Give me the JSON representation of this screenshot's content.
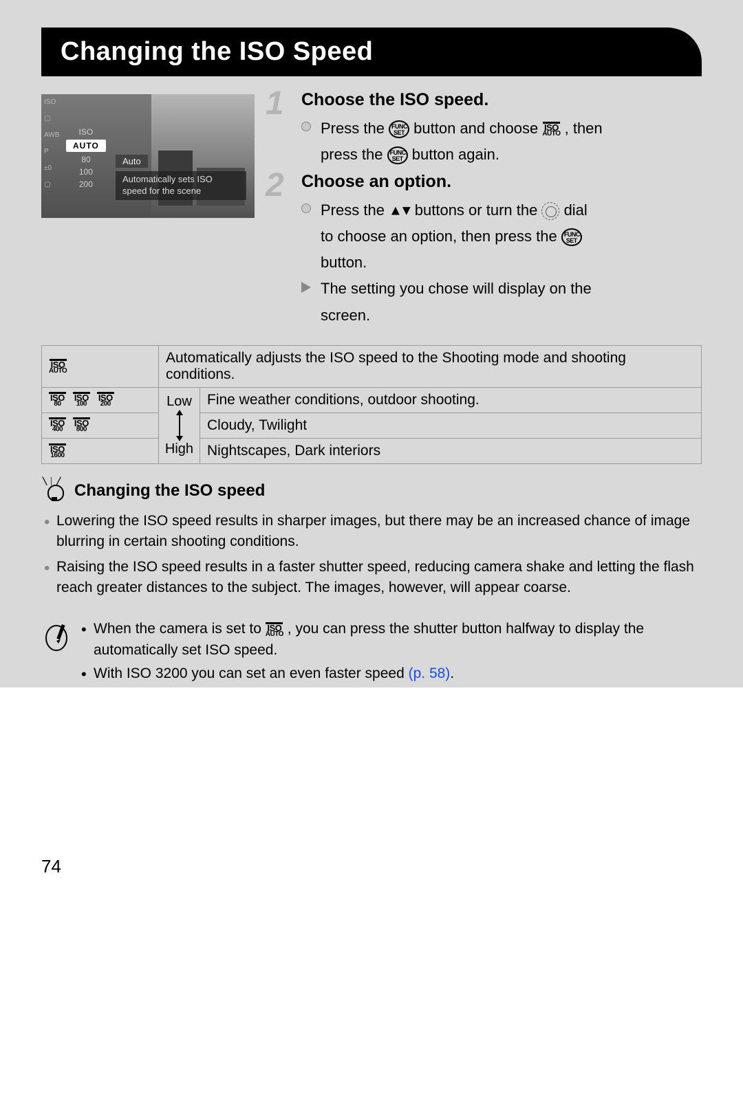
{
  "title": "Changing the ISO Speed",
  "lcd": {
    "auto_label": "Auto",
    "desc_line1": "Automatically sets ISO",
    "desc_line2": "speed for the scene",
    "col2_auto": "AUTO",
    "col2_80": "80",
    "col2_100": "100",
    "col2_200": "200"
  },
  "steps": [
    {
      "num": "1",
      "title": "Choose the ISO speed.",
      "lines": [
        {
          "type": "dot",
          "pre": "Press the ",
          "icon1": "func-set",
          "mid": " button and choose ",
          "icon2": "iso-auto",
          "post": ", then"
        },
        {
          "type": "cont",
          "pre": "press the ",
          "icon1": "func-set",
          "post": " button again."
        }
      ]
    },
    {
      "num": "2",
      "title": "Choose an option.",
      "lines": [
        {
          "type": "dot",
          "pre": "Press the ",
          "icon1": "updown",
          "mid": " buttons or turn the ",
          "icon2": "dial",
          "post": " dial"
        },
        {
          "type": "cont",
          "pre": "to choose an option, then press the ",
          "icon1": "func-set",
          "post": ""
        },
        {
          "type": "cont",
          "pre": "button.",
          "post": ""
        },
        {
          "type": "tri",
          "pre": "The setting you chose will display on the",
          "post": ""
        },
        {
          "type": "cont",
          "pre": "screen.",
          "post": ""
        }
      ]
    }
  ],
  "table": {
    "rows": [
      {
        "icons": [
          "AUTO"
        ],
        "level": "",
        "desc": "Automatically adjusts the ISO speed to the Shooting mode and shooting conditions."
      },
      {
        "icons": [
          "80",
          "100",
          "200"
        ],
        "level": "Low",
        "desc": "Fine weather conditions, outdoor shooting."
      },
      {
        "icons": [
          "400",
          "800"
        ],
        "level": "",
        "desc": "Cloudy, Twilight"
      },
      {
        "icons": [
          "1600"
        ],
        "level": "High",
        "desc": "Nightscapes, Dark interiors"
      }
    ]
  },
  "tip": {
    "title": "Changing the ISO speed",
    "items": [
      "Lowering the ISO speed results in sharper images, but there may be an increased chance of image blurring in certain shooting conditions.",
      "Raising the ISO speed results in a faster shutter speed, reducing camera shake and letting the flash reach greater distances to the subject. The images, however, will appear coarse."
    ]
  },
  "note": {
    "line1_pre": "When the camera is set to ",
    "line1_post": ", you can press the shutter button halfway to display the automatically set ISO speed.",
    "line2_pre": "With ISO 3200 you can set an even faster speed ",
    "line2_link": "(p. 58)",
    "line2_post": "."
  },
  "page_number": "74",
  "icon_labels": {
    "func": "FUNC.",
    "set": "SET",
    "iso": "ISO"
  }
}
